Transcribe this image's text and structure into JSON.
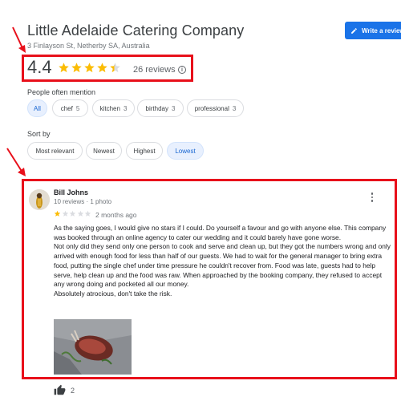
{
  "business": {
    "name": "Little Adelaide Catering Company",
    "address": "3 Finlayson St, Netherby SA, Australia"
  },
  "write_review": {
    "label": "Write a review",
    "icon": "pencil-icon"
  },
  "rating": {
    "value": "4.4",
    "stars": 4.4,
    "count_label": "26 reviews",
    "info_icon": "info-icon"
  },
  "mentions": {
    "title": "People often mention",
    "chips": [
      {
        "label": "All",
        "count": ""
      },
      {
        "label": "chef",
        "count": "5"
      },
      {
        "label": "kitchen",
        "count": "3"
      },
      {
        "label": "birthday",
        "count": "3"
      },
      {
        "label": "professional",
        "count": "3"
      }
    ]
  },
  "sort": {
    "title": "Sort by",
    "options": [
      "Most relevant",
      "Newest",
      "Highest",
      "Lowest"
    ],
    "selected": "Lowest"
  },
  "review": {
    "author": "Bill Johns",
    "meta": "10 reviews · 1 photo",
    "stars": 1,
    "date": "2 months ago",
    "paragraphs": [
      "As the saying goes, I would give no stars if I could. Do yourself a favour and go with anyone else. This company was booked through an online agency to cater our wedding and it could barely have gone worse.",
      "Not only did they send only one person to cook and serve and clean up, but they got the numbers wrong and only arrived with enough food for less than half of our guests. We had to wait for the general manager to bring extra food, putting the single chef under time pressure he couldn't recover from. Food was late, guests had to help serve, help clean up and the food was raw. When approached by the booking company, they refused to accept any wrong doing and pocketed all our money.",
      "Absolutely atrocious, don't take the risk."
    ],
    "likes": "2"
  },
  "colors": {
    "accent": "#1a73e8",
    "star": "#fbbc04",
    "annotation": "#e8101b"
  }
}
